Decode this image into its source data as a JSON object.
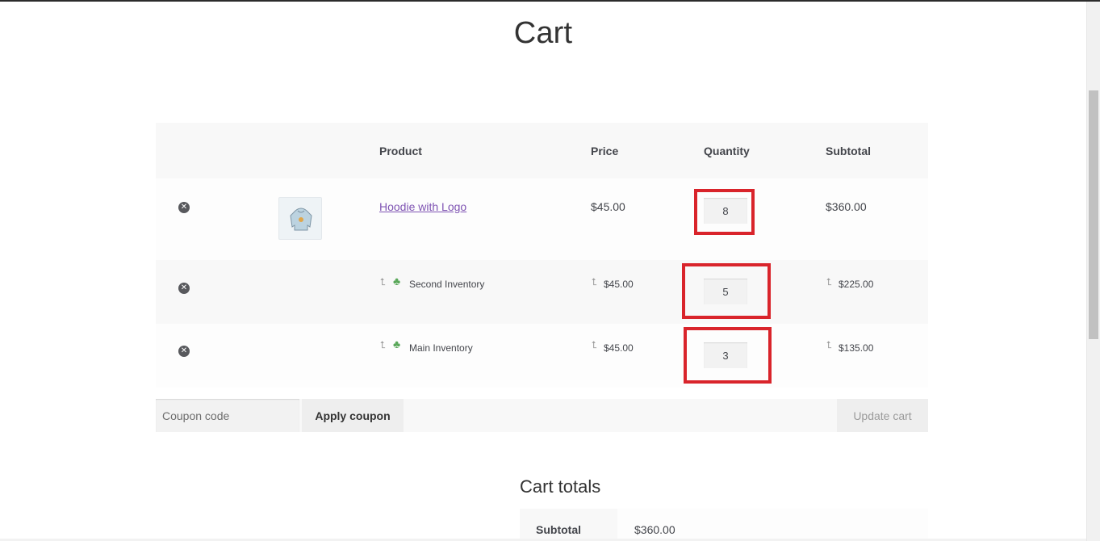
{
  "page": {
    "title": "Cart"
  },
  "cart": {
    "headers": {
      "product": "Product",
      "price": "Price",
      "quantity": "Quantity",
      "subtotal": "Subtotal"
    },
    "rows": [
      {
        "product": "Hoodie with Logo",
        "price": "$45.00",
        "quantity": "8",
        "subtotal": "$360.00",
        "remove_icon": "times-circle-icon",
        "thumbnail": "hoodie-thumbnail"
      },
      {
        "product": "Second Inventory",
        "price": "$45.00",
        "quantity": "5",
        "subtotal": "$225.00",
        "remove_icon": "times-circle-icon",
        "sub_icon": "corner-up-arrow-icon",
        "inventory_icon": "inventory-cubes-icon"
      },
      {
        "product": "Main Inventory",
        "price": "$45.00",
        "quantity": "3",
        "subtotal": "$135.00",
        "remove_icon": "times-circle-icon",
        "sub_icon": "corner-up-arrow-icon",
        "inventory_icon": "inventory-cubes-icon"
      }
    ]
  },
  "actions": {
    "coupon_placeholder": "Coupon code",
    "apply_label": "Apply coupon",
    "update_label": "Update cart"
  },
  "totals": {
    "title": "Cart totals",
    "subtotal_label": "Subtotal",
    "subtotal_value": "$360.00"
  },
  "colors": {
    "link": "#7f54b3",
    "highlight": "#d9242b",
    "inventory_icon": "#5aa85a",
    "header_bg": "#f8f8f8"
  }
}
